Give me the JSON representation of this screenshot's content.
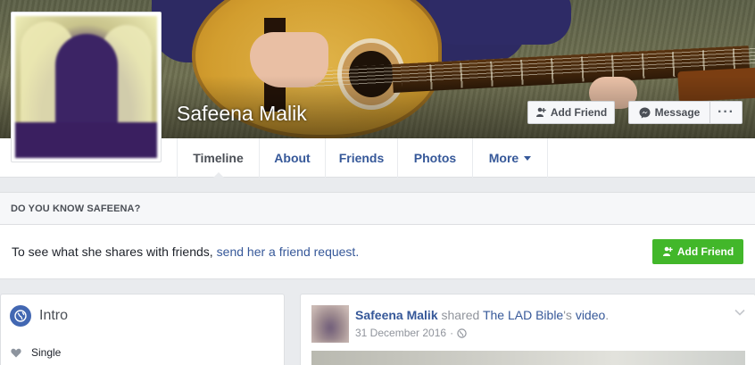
{
  "profile": {
    "name": "Safeena Malik"
  },
  "cover_actions": {
    "add_friend": "Add Friend",
    "message": "Message",
    "more": "···"
  },
  "tabs": [
    {
      "label": "Timeline",
      "active": true
    },
    {
      "label": "About"
    },
    {
      "label": "Friends"
    },
    {
      "label": "Photos"
    },
    {
      "label": "More"
    }
  ],
  "know_box": {
    "header": "DO YOU KNOW SAFEENA?",
    "text": "To see what she shares with friends,",
    "link": "send her a friend request.",
    "button": "Add Friend"
  },
  "intro": {
    "title": "Intro",
    "relationship": "Single"
  },
  "post": {
    "author": "Safeena Malik",
    "action": "shared",
    "page": "The LAD Bible",
    "possessive": "'s",
    "object": "video",
    "period": ".",
    "date": "31 December 2016",
    "separator": "·"
  },
  "colors": {
    "link": "#365899",
    "green": "#42b72a",
    "background": "#e9ebee"
  }
}
